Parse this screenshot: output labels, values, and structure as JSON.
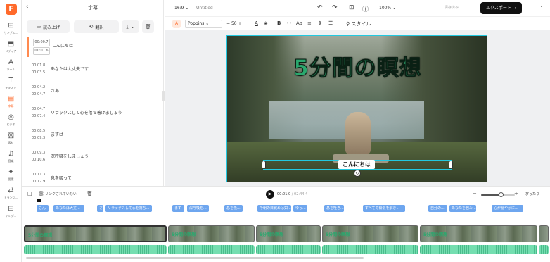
{
  "app": {
    "logo": "F"
  },
  "rail": {
    "items": [
      {
        "icon": "⊞",
        "label": "サンプル..."
      },
      {
        "icon": "⬒",
        "label": "メディア"
      },
      {
        "icon": "A̶",
        "label": "ツール"
      },
      {
        "icon": "T",
        "label": "テキスト"
      },
      {
        "icon": "▤",
        "label": "字幕"
      },
      {
        "icon": "◎",
        "label": "ビデオ"
      },
      {
        "icon": "▧",
        "label": "素材"
      },
      {
        "icon": "♫",
        "label": "音楽"
      },
      {
        "icon": "✦",
        "label": "要素"
      },
      {
        "icon": "⇄",
        "label": "トランジ..."
      },
      {
        "icon": "⊟",
        "label": "テンプ..."
      }
    ]
  },
  "panel": {
    "title": "字幕",
    "read_aloud": "読み上げ",
    "translate": "翻訳",
    "subtitles": [
      {
        "start": "00:00.7",
        "end": "00:01.6",
        "text": "こんにちは"
      },
      {
        "start": "00:01.8",
        "end": "00:03.5",
        "text": "あなたは大丈夫です"
      },
      {
        "start": "00:04.2",
        "end": "00:04.7",
        "text": "さあ"
      },
      {
        "start": "00:04.7",
        "end": "00:07.4",
        "text": "リラックスして心を落ち着けましょう"
      },
      {
        "start": "00:08.5",
        "end": "00:09.3",
        "text": "まずは"
      },
      {
        "start": "00:09.3",
        "end": "00:10.6",
        "text": "深呼吸をしましょう"
      },
      {
        "start": "00:11.3",
        "end": "00:12.9",
        "text": "息を吸って"
      }
    ]
  },
  "topbar": {
    "ratio": "16:9",
    "project_title": "Untitled",
    "zoom": "100%",
    "save_status": "保存済み",
    "export_label": "エクスポート"
  },
  "format": {
    "font": "Poppins",
    "size": "50",
    "style_label": "スタイル"
  },
  "video": {
    "title_text": "5分間の瞑想",
    "caption_text": "こんにちは"
  },
  "playbar": {
    "link_label": "リンクされていない",
    "current_time": "00:01.0",
    "duration": "/ 02:44.4",
    "fit_label": "ぴったり",
    "zoom_level": 0.58
  },
  "timeline": {
    "chips": [
      "こん",
      "あなたは大丈...",
      "さ",
      "リラックスして心を落ち...",
      "まず",
      "深呼吸を...",
      "息を吸...",
      "今朝の目覚めは如...",
      "ゆっ...",
      "息を吐き...",
      "すべての緊張を解き...",
      "自分の...",
      "あなたを包み...",
      "心が穏やかに..."
    ],
    "clip_label": "5分間の瞑想",
    "clips": 6
  }
}
